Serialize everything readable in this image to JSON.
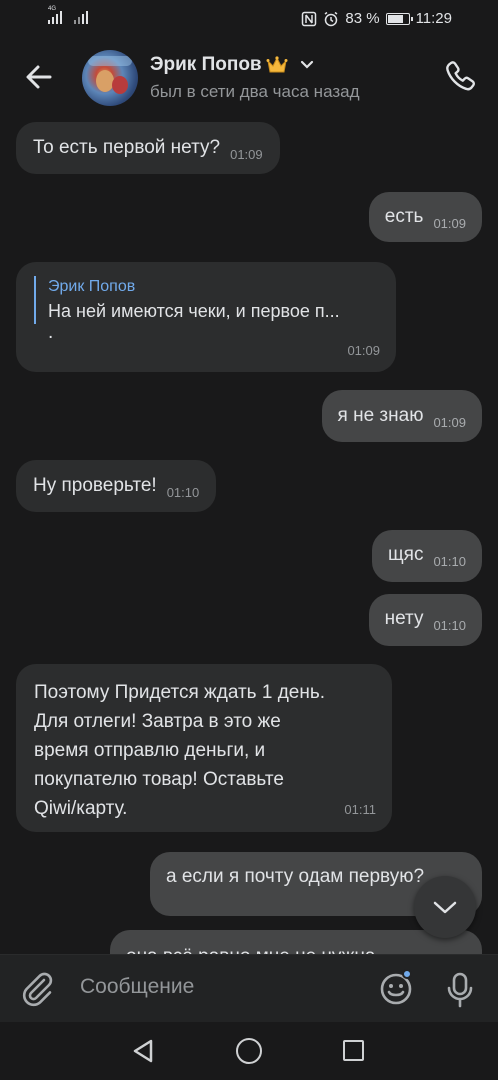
{
  "status_bar": {
    "network_label": "4G",
    "battery_percent": "83 %",
    "battery_level": 0.83,
    "time": "11:29",
    "icons": [
      "nfc-icon",
      "alarm-icon",
      "battery-icon",
      "signal-icon"
    ]
  },
  "header": {
    "contact_name": "Эрик Попов",
    "status": "был в сети два часа назад",
    "icons": [
      "back-arrow-icon",
      "crown-icon",
      "chevron-down-icon",
      "phone-icon"
    ]
  },
  "messages": [
    {
      "direction": "in",
      "text": "То есть первой нету?",
      "time": "01:09"
    },
    {
      "direction": "out",
      "text": "есть",
      "time": "01:09"
    },
    {
      "direction": "in",
      "reply_to_name": "Эрик Попов",
      "reply_to_text": "На ней имеются чеки, и первое п...",
      "text": ".",
      "time": "01:09"
    },
    {
      "direction": "out",
      "text": "я не знаю",
      "time": "01:09"
    },
    {
      "direction": "in",
      "text": "Ну проверьте!",
      "time": "01:10"
    },
    {
      "direction": "out",
      "text": "щяс",
      "time": "01:10"
    },
    {
      "direction": "out",
      "text": "нету",
      "time": "01:10"
    },
    {
      "direction": "in",
      "lines": [
        "Поэтому Придется ждать 1 день.",
        "Для отлеги! Завтра в это же",
        "время отправлю деньги, и",
        "покупателю товар! Оставьте",
        "Qiwi/карту."
      ],
      "time": "01:11"
    },
    {
      "direction": "out",
      "text": "а если я почту одам первую?",
      "time": ""
    },
    {
      "direction": "out",
      "text": "она всё равно мне не нужна",
      "time": ""
    }
  ],
  "composer": {
    "placeholder": "Сообщение",
    "icons": [
      "paperclip-icon",
      "emoji-icon",
      "microphone-icon"
    ]
  },
  "nav_bar": {
    "icons": [
      "nav-back-icon",
      "nav-home-icon",
      "nav-recent-icon"
    ]
  },
  "colors": {
    "background": "#19191a",
    "incoming_bubble": "#2c2d2e",
    "outgoing_bubble": "#454647",
    "accent": "#71aaeb",
    "secondary_text": "#939699"
  }
}
